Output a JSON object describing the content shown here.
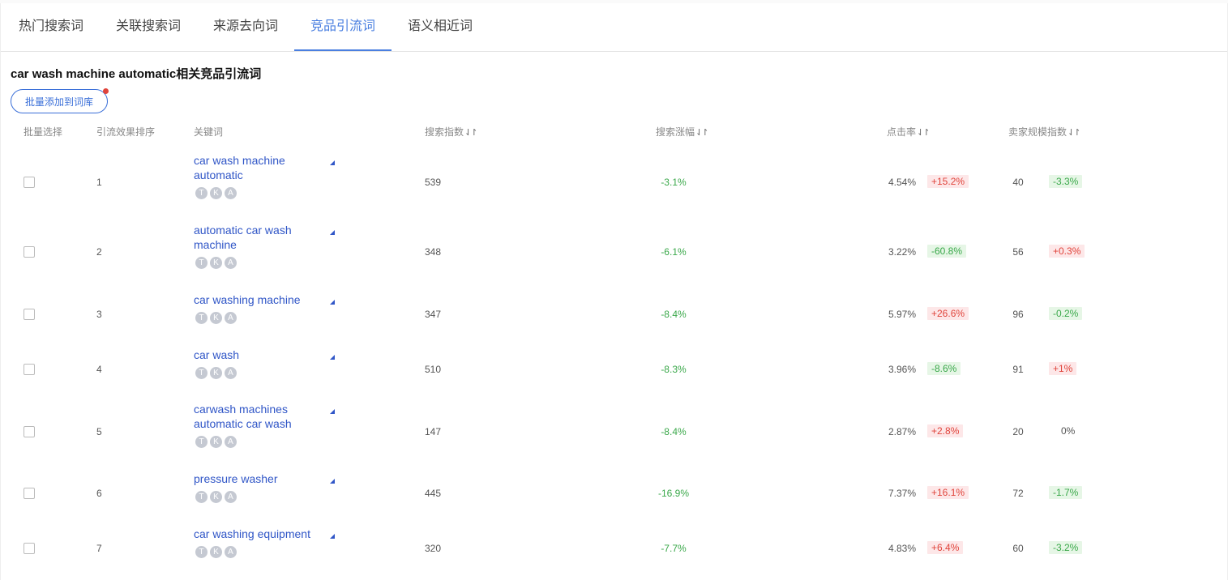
{
  "tabs": [
    {
      "label": "热门搜索词"
    },
    {
      "label": "关联搜索词"
    },
    {
      "label": "来源去向词"
    },
    {
      "label": "竞品引流词"
    },
    {
      "label": "语义相近词"
    }
  ],
  "title": "car wash machine automatic相关竞品引流词",
  "batch_button": "批量添加到词库",
  "headers": {
    "select": "批量选择",
    "rank": "引流效果排序",
    "keyword": "关键词",
    "search_index": "搜索指数",
    "search_growth": "搜索涨幅",
    "ctr": "点击率",
    "seller_scale": "卖家规模指数"
  },
  "sort_glyph": "⇃↾",
  "badge_letters": [
    "T",
    "K",
    "A"
  ],
  "colors": {
    "accent": "#4a7fe0",
    "link": "#3056c7",
    "up": "#e0443b",
    "down": "#3aa84a"
  },
  "rows": [
    {
      "rank": "1",
      "keyword": "car wash machine automatic",
      "search_index": "539",
      "growth": "-3.1%",
      "ctr": "4.54%",
      "ctr_change": "+15.2%",
      "seller": "40",
      "seller_change": "-3.3%"
    },
    {
      "rank": "2",
      "keyword": "automatic car wash machine",
      "search_index": "348",
      "growth": "-6.1%",
      "ctr": "3.22%",
      "ctr_change": "-60.8%",
      "seller": "56",
      "seller_change": "+0.3%"
    },
    {
      "rank": "3",
      "keyword": "car washing machine",
      "search_index": "347",
      "growth": "-8.4%",
      "ctr": "5.97%",
      "ctr_change": "+26.6%",
      "seller": "96",
      "seller_change": "-0.2%"
    },
    {
      "rank": "4",
      "keyword": "car wash",
      "search_index": "510",
      "growth": "-8.3%",
      "ctr": "3.96%",
      "ctr_change": "-8.6%",
      "seller": "91",
      "seller_change": "+1%"
    },
    {
      "rank": "5",
      "keyword": "carwash machines automatic car wash",
      "search_index": "147",
      "growth": "-8.4%",
      "ctr": "2.87%",
      "ctr_change": "+2.8%",
      "seller": "20",
      "seller_change": "0%"
    },
    {
      "rank": "6",
      "keyword": "pressure washer",
      "search_index": "445",
      "growth": "-16.9%",
      "ctr": "7.37%",
      "ctr_change": "+16.1%",
      "seller": "72",
      "seller_change": "-1.7%"
    },
    {
      "rank": "7",
      "keyword": "car washing equipment",
      "search_index": "320",
      "growth": "-7.7%",
      "ctr": "4.83%",
      "ctr_change": "+6.4%",
      "seller": "60",
      "seller_change": "-3.2%"
    }
  ]
}
